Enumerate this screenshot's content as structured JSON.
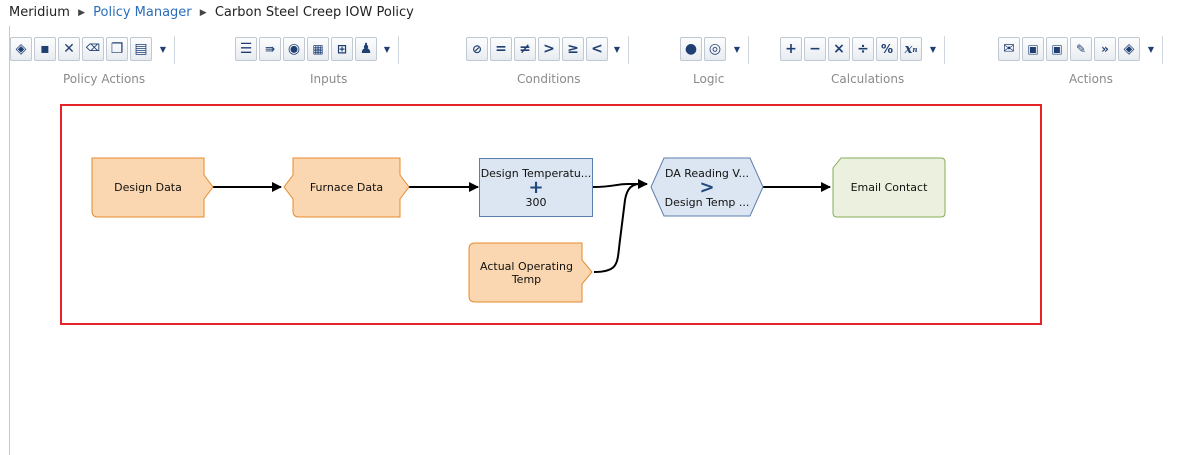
{
  "breadcrumb": {
    "items": [
      "Meridium",
      "Policy Manager",
      "Carbon Steel Creep IOW Policy"
    ]
  },
  "toolbar": {
    "groups": [
      "Policy Actions",
      "Inputs",
      "Conditions",
      "Logic",
      "Calculations",
      "Actions"
    ],
    "conditions": [
      "=",
      "≠",
      ">",
      "≥",
      "<"
    ],
    "calculations": [
      "+",
      "−",
      "×",
      "÷",
      "%"
    ]
  },
  "canvas": {
    "nodes": {
      "design_data": "Design Data",
      "furnace_data": "Furnace Data",
      "calc_top": "Design Temperatu...",
      "calc_op": "+",
      "calc_bottom": "300",
      "actual_temp_line1": "Actual Operating",
      "actual_temp_line2": "Temp",
      "cond_top": "DA Reading V...",
      "cond_op": ">",
      "cond_bottom": "Design Temp ...",
      "email_contact": "Email Contact"
    }
  },
  "colors": {
    "input_fill": "#fad7b0",
    "input_border": "#e58a2e",
    "calc_fill": "#dce6f2",
    "action_fill": "#ebf1de",
    "selection": "#e52329",
    "link": "#2a6ebb"
  }
}
